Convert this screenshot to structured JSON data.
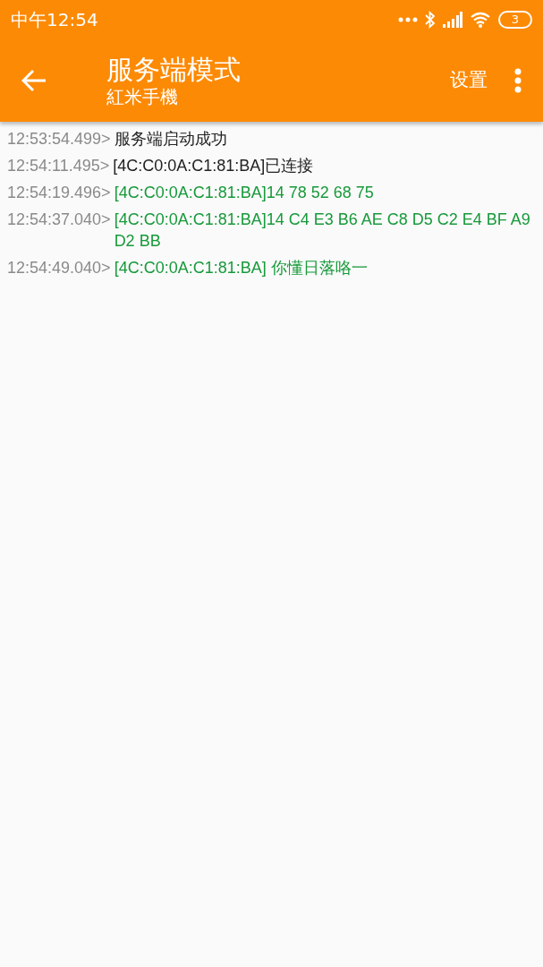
{
  "status_bar": {
    "time": "中午12:54",
    "battery": "3"
  },
  "toolbar": {
    "title": "服务端模式",
    "subtitle": "紅米手機",
    "action": "设置"
  },
  "log": [
    {
      "time": "12:53:54.499>",
      "message": "服务端启动成功",
      "kind": "info"
    },
    {
      "time": "12:54:11.495>",
      "message": "[4C:C0:0A:C1:81:BA]已连接",
      "kind": "info"
    },
    {
      "time": "12:54:19.496>",
      "message": "[4C:C0:0A:C1:81:BA]14 78 52 68 75",
      "kind": "data"
    },
    {
      "time": "12:54:37.040>",
      "message": "[4C:C0:0A:C1:81:BA]14 C4 E3 B6 AE C8 D5 C2 E4 BF A9 D2 BB",
      "kind": "data"
    },
    {
      "time": "12:54:49.040>",
      "message": "[4C:C0:0A:C1:81:BA] 你懂日落咯一",
      "kind": "data"
    }
  ]
}
